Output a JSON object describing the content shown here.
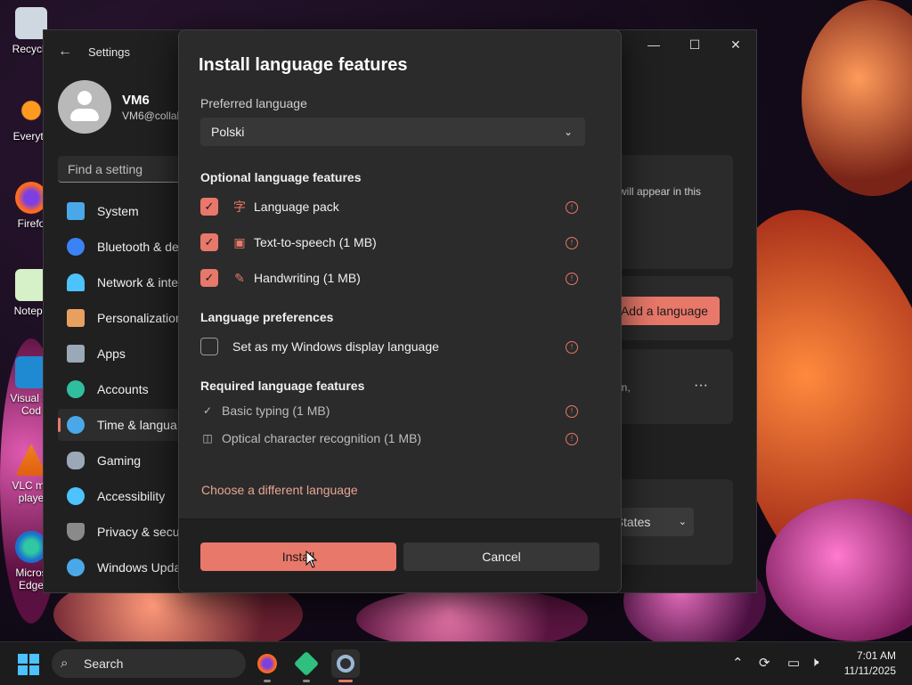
{
  "desktop": {
    "icons": [
      {
        "label": "Recycle",
        "icon": "recycle-bin-icon"
      },
      {
        "label": "Everyth",
        "icon": "everything-search-icon"
      },
      {
        "label": "Firefo",
        "icon": "firefox-icon"
      },
      {
        "label": "Notepa",
        "icon": "notepad-icon"
      },
      {
        "label": "Visual St",
        "label2": "Cod",
        "icon": "vscode-icon"
      },
      {
        "label": "VLC me",
        "label2": "playe",
        "icon": "vlc-icon"
      },
      {
        "label": "Micros",
        "label2": "Edge",
        "icon": "edge-icon"
      }
    ]
  },
  "settings": {
    "title": "Settings",
    "profile": {
      "name": "VM6",
      "email": "VM6@collal"
    },
    "search_placeholder": "Find a setting",
    "nav": [
      {
        "label": "System",
        "icon": "monitor-icon",
        "color": "#4aa8e8"
      },
      {
        "label": "Bluetooth & de",
        "icon": "bluetooth-icon",
        "color": "#3b82f6"
      },
      {
        "label": "Network & inte",
        "icon": "wifi-icon",
        "color": "#4cc2ff"
      },
      {
        "label": "Personalization",
        "icon": "brush-icon",
        "color": "#e8a060"
      },
      {
        "label": "Apps",
        "icon": "apps-icon",
        "color": "#9aa8b8"
      },
      {
        "label": "Accounts",
        "icon": "person-icon",
        "color": "#2fbf9f"
      },
      {
        "label": "Time & langua",
        "icon": "globe-clock-icon",
        "color": "#4aa8e8",
        "active": true
      },
      {
        "label": "Gaming",
        "icon": "gamepad-icon",
        "color": "#9aa8b8"
      },
      {
        "label": "Accessibility",
        "icon": "accessibility-icon",
        "color": "#4cc2ff"
      },
      {
        "label": "Privacy & secu",
        "icon": "shield-icon",
        "color": "#8a8a8a"
      },
      {
        "label": "Windows Upda",
        "icon": "update-icon",
        "color": "#4aa8e8"
      }
    ],
    "bg_text_1": "will appear in this",
    "add_language_label": "Add a language",
    "bg_text_2": "on,",
    "more_label": "···",
    "region_value": "d States"
  },
  "dialog": {
    "title": "Install language features",
    "preferred_label": "Preferred language",
    "preferred_value": "Polski",
    "optional_heading": "Optional language features",
    "optional": [
      {
        "label": "Language pack",
        "checked": true,
        "icon": "language-pack-icon"
      },
      {
        "label": "Text-to-speech (1 MB)",
        "checked": true,
        "icon": "speech-icon"
      },
      {
        "label": "Handwriting (1 MB)",
        "checked": true,
        "icon": "handwriting-icon"
      }
    ],
    "prefs_heading": "Language preferences",
    "display_lang_label": "Set as my Windows display language",
    "display_lang_checked": false,
    "required_heading": "Required language features",
    "required": [
      {
        "label": "Basic typing (1 MB)",
        "icon": "typing-icon"
      },
      {
        "label": "Optical character recognition (1 MB)",
        "icon": "ocr-icon"
      }
    ],
    "choose_link": "Choose a different language",
    "install_label": "Install",
    "cancel_label": "Cancel"
  },
  "taskbar": {
    "search_label": "Search",
    "apps": [
      "firefox-icon",
      "app-cube-icon",
      "settings-gear-icon"
    ],
    "time": "7:01 AM",
    "date": "11/11/2025"
  },
  "colors": {
    "accent": "#e8786a"
  }
}
